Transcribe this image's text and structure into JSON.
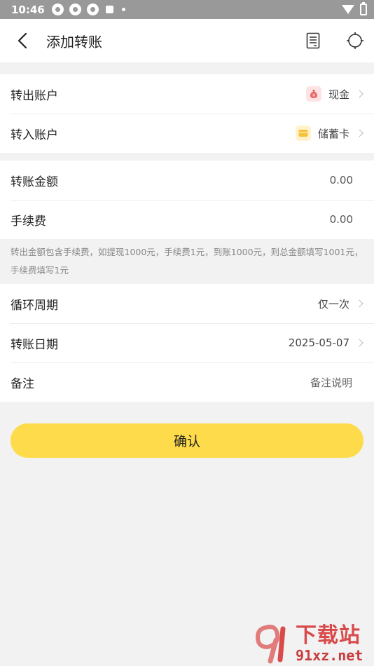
{
  "status_bar": {
    "time": "10:46"
  },
  "header": {
    "title": "添加转账"
  },
  "accounts": {
    "from_label": "转出账户",
    "from_value": "现金",
    "to_label": "转入账户",
    "to_value": "储蓄卡"
  },
  "amounts": {
    "amount_label": "转账金额",
    "amount_value": "0.00",
    "fee_label": "手续费",
    "fee_value": "0.00"
  },
  "hint": "转出金额包含手续费，如提现1000元，手续费1元，到账1000元，则总金额填写1001元，手续费填写1元",
  "details": {
    "cycle_label": "循环周期",
    "cycle_value": "仅一次",
    "date_label": "转账日期",
    "date_value": "2025-05-07",
    "note_label": "备注",
    "note_placeholder": "备注说明"
  },
  "confirm_label": "确认",
  "watermark": {
    "cn": "下载站",
    "en": "91xz.net"
  },
  "colors": {
    "accent": "#fedb4b",
    "status_bar": "#999999",
    "background": "#f2f2f2"
  }
}
